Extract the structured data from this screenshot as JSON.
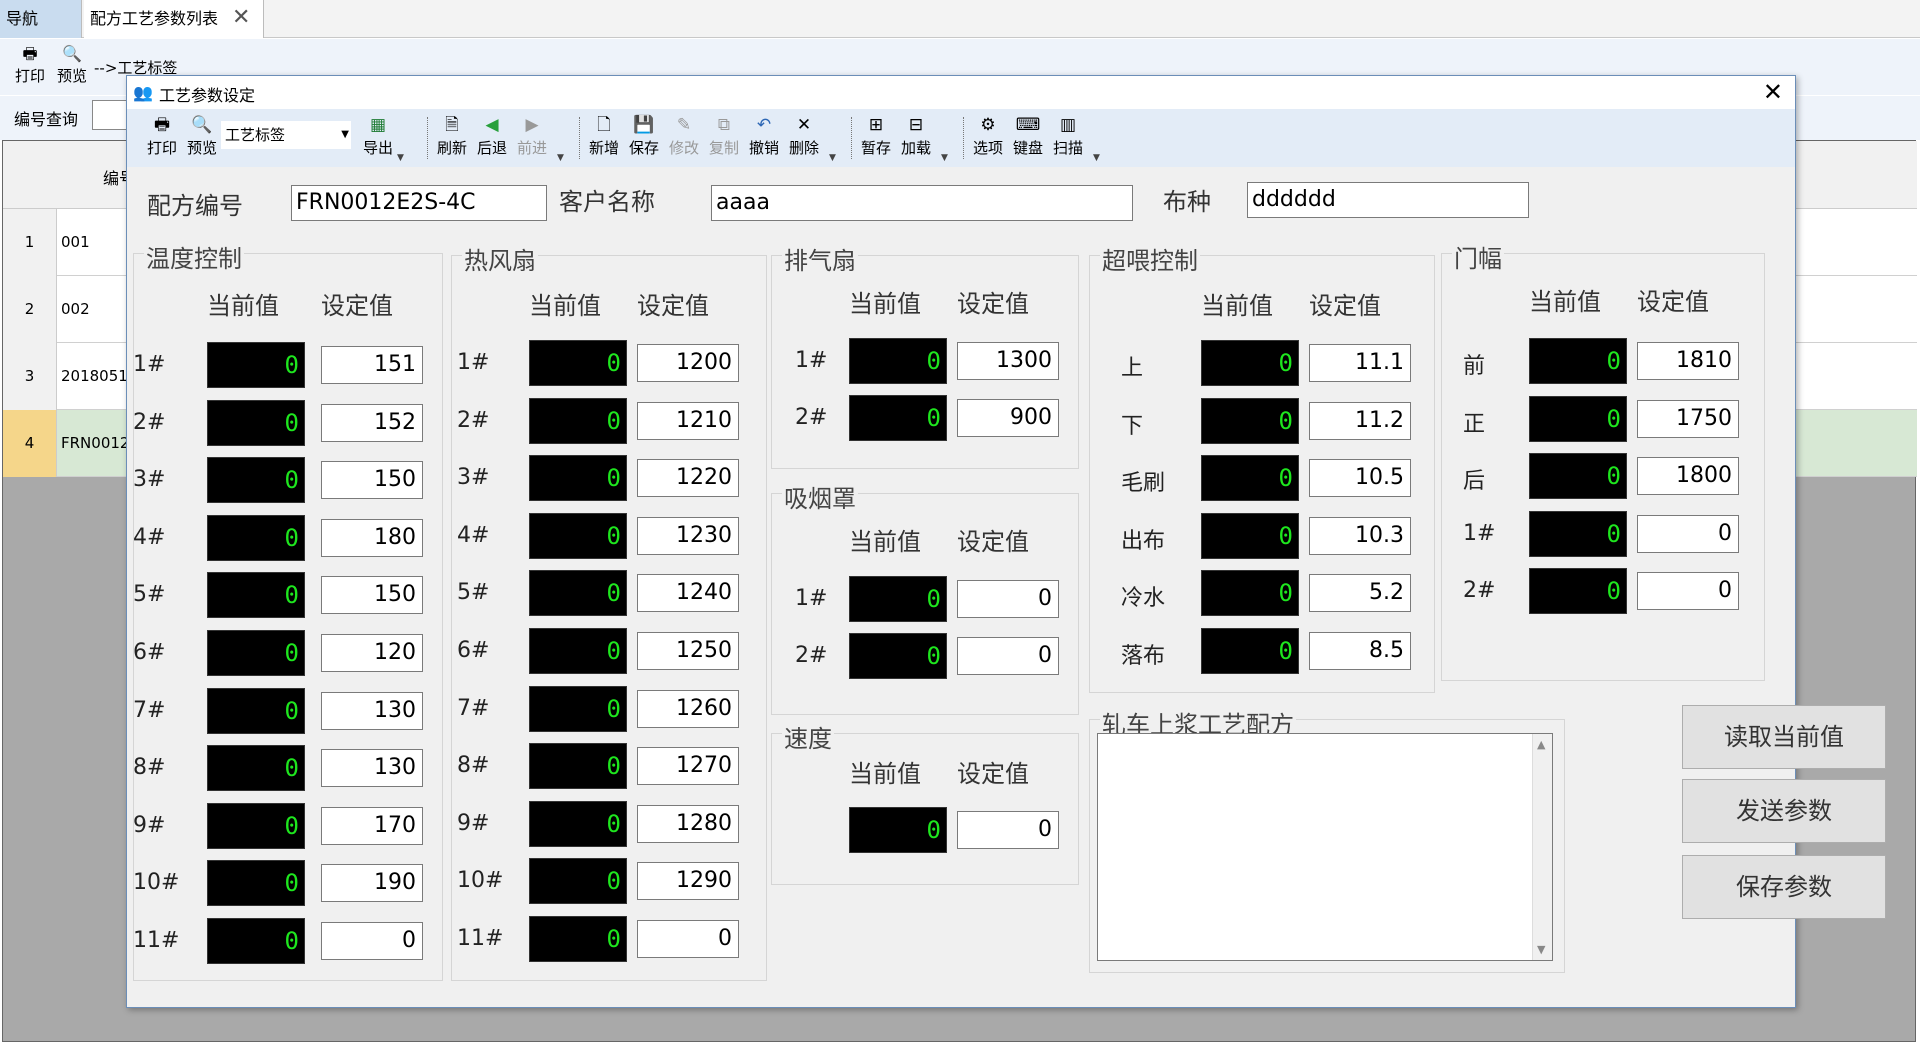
{
  "tabs": {
    "nav": "导航",
    "list": "配方工艺参数列表"
  },
  "bg_toolbar": {
    "print": "打印",
    "preview": "预览",
    "combo": "-->工艺标签"
  },
  "bg_search_label": "编号查询",
  "grid": {
    "rows": [
      {
        "num": "1",
        "code": "001"
      },
      {
        "num": "2",
        "code": "002"
      },
      {
        "num": "3",
        "code": "2018051"
      },
      {
        "num": "4",
        "code": "FRN0012"
      }
    ],
    "selected_row_color": "#f5d68a"
  },
  "dialog": {
    "title": "工艺参数设定",
    "toolbar": {
      "print": "打印",
      "preview": "预览",
      "combo": "工艺标签",
      "export": "导出",
      "refresh": "刷新",
      "back": "后退",
      "forward": "前进",
      "new": "新增",
      "save": "保存",
      "modify": "修改",
      "copy": "复制",
      "undo": "撤销",
      "delete": "删除",
      "hold": "暂存",
      "load": "加载",
      "options": "选项",
      "keyboard": "键盘",
      "scan": "扫描"
    },
    "recipe_no_label": "配方编号",
    "recipe_no": "FRN0012E2S-4C",
    "customer_label": "客户名称",
    "customer": "aaaa",
    "fabric_label": "布种",
    "fabric": "dddddd",
    "col_current": "当前值",
    "col_set": "设定值",
    "temperature": {
      "title": "温度控制",
      "rows": [
        {
          "label": "1#",
          "cur": "0",
          "set": "151"
        },
        {
          "label": "2#",
          "cur": "0",
          "set": "152"
        },
        {
          "label": "3#",
          "cur": "0",
          "set": "150"
        },
        {
          "label": "4#",
          "cur": "0",
          "set": "180"
        },
        {
          "label": "5#",
          "cur": "0",
          "set": "150"
        },
        {
          "label": "6#",
          "cur": "0",
          "set": "120"
        },
        {
          "label": "7#",
          "cur": "0",
          "set": "130"
        },
        {
          "label": "8#",
          "cur": "0",
          "set": "130"
        },
        {
          "label": "9#",
          "cur": "0",
          "set": "170"
        },
        {
          "label": "10#",
          "cur": "0",
          "set": "190"
        },
        {
          "label": "11#",
          "cur": "0",
          "set": "0"
        }
      ]
    },
    "hot_fan": {
      "title": "热风扇",
      "rows": [
        {
          "label": "1#",
          "cur": "0",
          "set": "1200"
        },
        {
          "label": "2#",
          "cur": "0",
          "set": "1210"
        },
        {
          "label": "3#",
          "cur": "0",
          "set": "1220"
        },
        {
          "label": "4#",
          "cur": "0",
          "set": "1230"
        },
        {
          "label": "5#",
          "cur": "0",
          "set": "1240"
        },
        {
          "label": "6#",
          "cur": "0",
          "set": "1250"
        },
        {
          "label": "7#",
          "cur": "0",
          "set": "1260"
        },
        {
          "label": "8#",
          "cur": "0",
          "set": "1270"
        },
        {
          "label": "9#",
          "cur": "0",
          "set": "1280"
        },
        {
          "label": "10#",
          "cur": "0",
          "set": "1290"
        },
        {
          "label": "11#",
          "cur": "0",
          "set": "0"
        }
      ]
    },
    "exhaust": {
      "title": "排气扇",
      "rows": [
        {
          "label": "1#",
          "cur": "0",
          "set": "1300"
        },
        {
          "label": "2#",
          "cur": "0",
          "set": "900"
        }
      ]
    },
    "smoke_hood": {
      "title": "吸烟罩",
      "rows": [
        {
          "label": "1#",
          "cur": "0",
          "set": "0"
        },
        {
          "label": "2#",
          "cur": "0",
          "set": "0"
        }
      ]
    },
    "speed": {
      "title": "速度",
      "cur": "0",
      "set": "0"
    },
    "overfeed": {
      "title": "超喂控制",
      "rows": [
        {
          "label": "上",
          "cur": "0",
          "set": "11.1"
        },
        {
          "label": "下",
          "cur": "0",
          "set": "11.2"
        },
        {
          "label": "毛刷",
          "cur": "0",
          "set": "10.5"
        },
        {
          "label": "出布",
          "cur": "0",
          "set": "10.3"
        },
        {
          "label": "冷水",
          "cur": "0",
          "set": "5.2"
        },
        {
          "label": "落布",
          "cur": "0",
          "set": "8.5"
        }
      ]
    },
    "width": {
      "title": "门幅",
      "rows": [
        {
          "label": "前",
          "cur": "0",
          "set": "1810"
        },
        {
          "label": "正",
          "cur": "0",
          "set": "1750"
        },
        {
          "label": "后",
          "cur": "0",
          "set": "1800"
        },
        {
          "label": "1#",
          "cur": "0",
          "set": "0"
        },
        {
          "label": "2#",
          "cur": "0",
          "set": "0"
        }
      ]
    },
    "padding_recipe": {
      "title": "轧车上浆工艺配方",
      "text": ""
    },
    "buttons": {
      "read": "读取当前值",
      "send": "发送参数",
      "save": "保存参数"
    }
  },
  "colors": {
    "led_bg": "#000000",
    "led_fg": "#1ee61e",
    "toolbar_bg": "#e3ecf7",
    "accent": "#2d67b5"
  }
}
